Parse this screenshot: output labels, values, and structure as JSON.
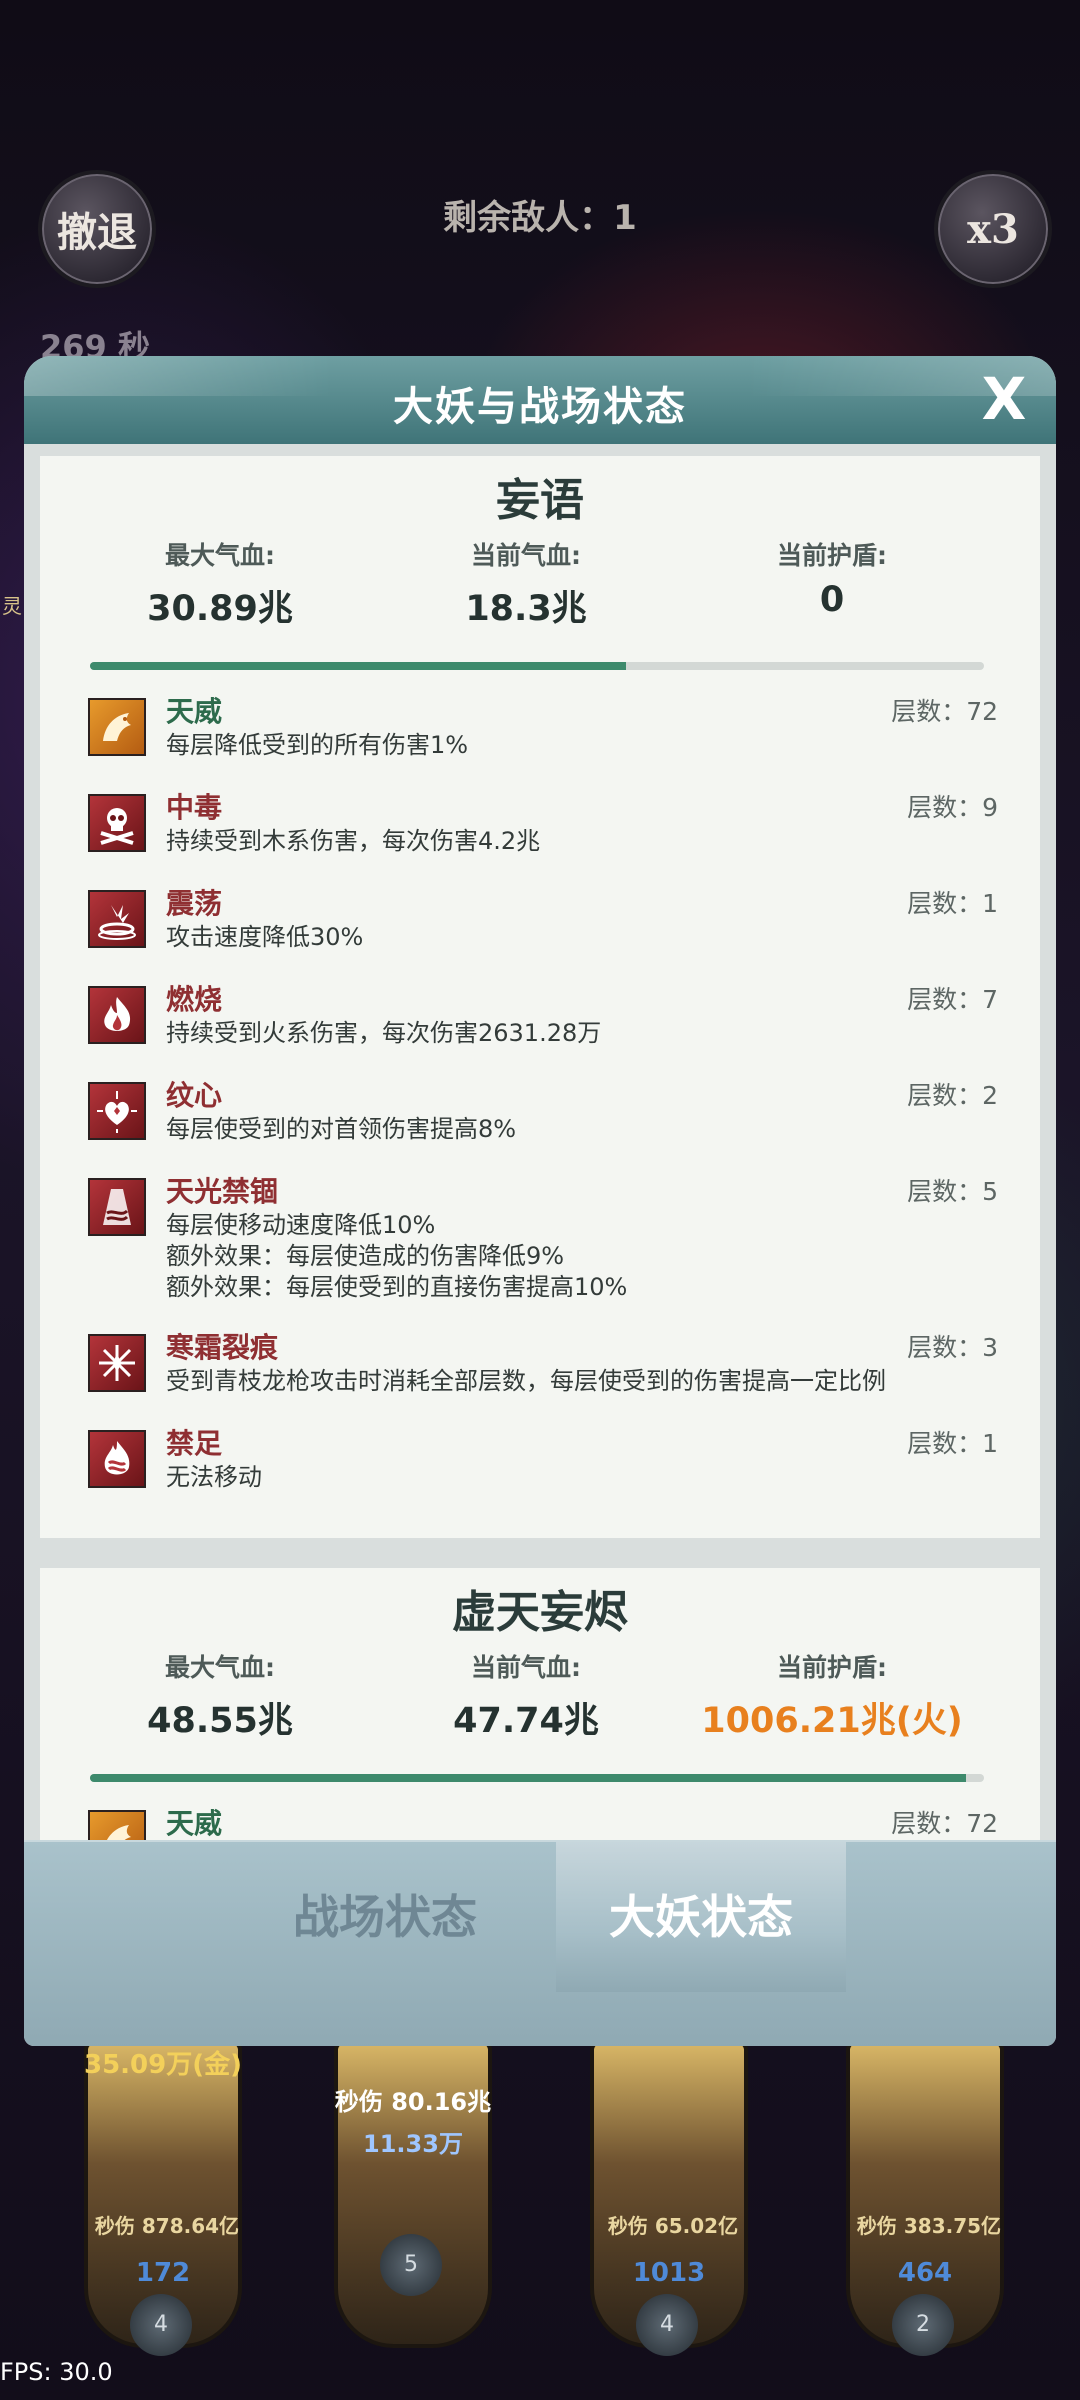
{
  "hud": {
    "retreat_label": "撤退",
    "speed_label": "x3",
    "enemy_count": "剩余敌人：1",
    "timer": "269 秒",
    "side_glyph": "灵"
  },
  "modal": {
    "title": "大妖与战场状态",
    "close_label": "X",
    "boss1": {
      "name": "妄语",
      "max_hp_label": "最大气血:",
      "max_hp": "30.89兆",
      "cur_hp_label": "当前气血:",
      "cur_hp": "18.3兆",
      "shield_label": "当前护盾:",
      "shield": "0",
      "hp_fraction": 0.6,
      "effects": [
        {
          "name": "天威",
          "stack": "层数：72",
          "desc": "每层降低受到的所有伤害1%",
          "icon": "dragon-icon"
        },
        {
          "name": "中毒",
          "stack": "层数：9",
          "desc": "持续受到木系伤害，每次伤害4.2兆",
          "icon": "skull-icon"
        },
        {
          "name": "震荡",
          "stack": "层数：1",
          "desc": "攻击速度降低30%",
          "icon": "shockwave-icon"
        },
        {
          "name": "燃烧",
          "stack": "层数：7",
          "desc": "持续受到火系伤害，每次伤害2631.28万",
          "icon": "flame-icon"
        },
        {
          "name": "纹心",
          "stack": "层数：2",
          "desc": "每层使受到的对首领伤害提高8%",
          "icon": "heart-sigil-icon"
        },
        {
          "name": "天光禁锢",
          "stack": "层数：5",
          "desc": "每层使移动速度降低10%",
          "desc2": "额外效果：每层使造成的伤害降低9%",
          "desc3": "额外效果：每层使受到的直接伤害提高10%",
          "icon": "chain-light-icon"
        },
        {
          "name": "寒霜裂痕",
          "stack": "层数：3",
          "desc": "受到青枝龙枪攻击时消耗全部层数，每层使受到的伤害提高一定比例",
          "icon": "frost-icon"
        },
        {
          "name": "禁足",
          "stack": "层数：1",
          "desc": "无法移动",
          "icon": "bind-icon"
        }
      ]
    },
    "boss2": {
      "name": "虚天妄烬",
      "max_hp_label": "最大气血:",
      "max_hp": "48.55兆",
      "cur_hp_label": "当前气血:",
      "cur_hp": "47.74兆",
      "shield_label": "当前护盾:",
      "shield": "1006.21兆(火)",
      "hp_fraction": 0.98,
      "effects": [
        {
          "name": "天威",
          "stack": "层数：72"
        }
      ]
    },
    "tabs": [
      {
        "label": "战场状态",
        "active": false
      },
      {
        "label": "大妖状态",
        "active": true
      }
    ]
  },
  "heroes": [
    {
      "top_val": "35.09万(金)",
      "dps": "秒伤 878.64亿",
      "level": "172",
      "stars": "4"
    },
    {
      "top_val2": "秒伤 80.16兆",
      "sub": "11.33万",
      "level": "",
      "stars": "5"
    },
    {
      "dps": "秒伤 65.02亿",
      "level": "1013",
      "stars": "4"
    },
    {
      "dps": "秒伤 383.75亿",
      "level": "464",
      "stars": "2"
    }
  ],
  "fps": "FPS: 30.0",
  "colors": {
    "accent": "#3f7478",
    "fire": "#e8801e",
    "debuff_name": "#8f2f32",
    "buff_name": "#2d6b4c"
  }
}
